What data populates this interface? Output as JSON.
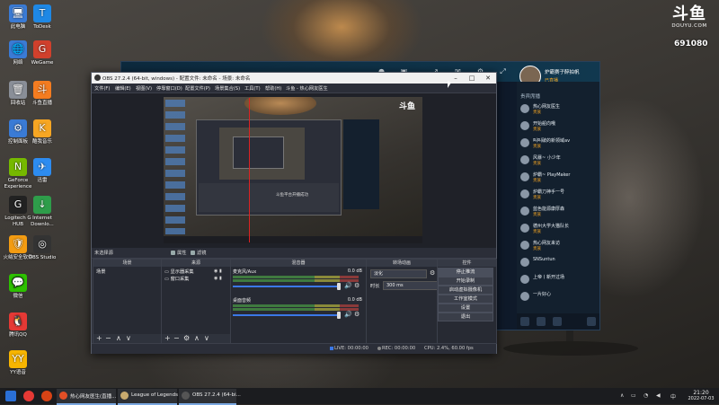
{
  "desktop_icons": [
    {
      "label": "此电脑",
      "color": "#3a7bd5",
      "glyph": "🖥"
    },
    {
      "label": "ToDesk",
      "color": "#1e88e5",
      "glyph": "T"
    },
    {
      "label": "网络",
      "color": "#3a7bd5",
      "glyph": "🌐"
    },
    {
      "label": "WeGame",
      "color": "#d0402c",
      "glyph": "G"
    },
    {
      "label": "回收站",
      "color": "#8a8f98",
      "glyph": "🗑"
    },
    {
      "label": "斗鱼直播",
      "color": "#f47c20",
      "glyph": "斗"
    },
    {
      "label": "控制面板",
      "color": "#3a7bd5",
      "glyph": "⚙"
    },
    {
      "label": "酷我音乐",
      "color": "#f6a623",
      "glyph": "K"
    },
    {
      "label": "GeForce Experience",
      "color": "#76b900",
      "glyph": "N"
    },
    {
      "label": "迅雷",
      "color": "#2d8cf0",
      "glyph": "✈"
    },
    {
      "label": "Logitech G HUB",
      "color": "#222222",
      "glyph": "G"
    },
    {
      "label": "Internet Downlo...",
      "color": "#2e9d4a",
      "glyph": "↓"
    },
    {
      "label": "火绒安全软件",
      "color": "#f39c12",
      "glyph": "🛡"
    },
    {
      "label": "OBS Studio",
      "color": "#333333",
      "glyph": "◎"
    },
    {
      "label": "微信",
      "color": "#2dc100",
      "glyph": "💬"
    },
    {
      "label": "腾讯QQ",
      "color": "#e53935",
      "glyph": "🐧"
    },
    {
      "label": "YY语音",
      "color": "#f7b500",
      "glyph": "YY"
    }
  ],
  "douyu_logo": {
    "mark": "斗鱼",
    "domain": "DOUYU.COM"
  },
  "room_id": "691080",
  "douyu_window": {
    "streamer_name": "炉霸赛子醉拍帆",
    "streamer_status": "已直播",
    "panel_header": "贵宾席播",
    "viewers": [
      {
        "name": "热心网友医生",
        "level": "贵族"
      },
      {
        "name": "开始船向哦",
        "level": "贵族"
      },
      {
        "name": "叫叫破的新领域av",
        "level": "贵族"
      },
      {
        "name": "风暴~ 小少年",
        "level": "贵族"
      },
      {
        "name": "炉霸~ PlayMaker",
        "level": "贵族"
      },
      {
        "name": "炉霸刀神手一号",
        "level": "贵族"
      },
      {
        "name": "蓝色能源康厚森",
        "level": "贵族"
      },
      {
        "name": "德州大学大猫队长",
        "level": "贵族"
      },
      {
        "name": "热心网友来访",
        "level": "贵族"
      },
      {
        "name": "SNSuntun",
        "level": ""
      },
      {
        "name": "上帝丨新开过场",
        "level": ""
      },
      {
        "name": "一片好心",
        "level": ""
      }
    ]
  },
  "obs": {
    "title": "OBS 27.2.4 (64-bit, windows) - 配置文件: 未命名 - 场景: 未命名",
    "window_buttons": [
      "–",
      "□",
      "✕"
    ],
    "menu": [
      "文件(F)",
      "编辑(E)",
      "视图(V)",
      "停靠窗口(D)",
      "配置文件(P)",
      "场景集合(S)",
      "工具(T)",
      "帮助(H)",
      "斗鱼 - 热心网友医生"
    ],
    "preview_inner_text": "斗鱼平台开播成功",
    "preview_logo": "斗鱼",
    "source_bar": {
      "label": "未选择源",
      "properties": "属性",
      "filters": "滤镜"
    },
    "docks": {
      "scenes": {
        "title": "场景",
        "items": [
          "场景"
        ]
      },
      "sources": {
        "title": "来源",
        "items": [
          "显示器采集",
          "窗口采集"
        ]
      },
      "mixer": {
        "title": "混音器",
        "channels": [
          {
            "name": "麦克风/Aux",
            "db": "0.0 dB"
          },
          {
            "name": "桌面音频",
            "db": "0.0 dB"
          }
        ]
      },
      "transitions": {
        "title": "转场动画",
        "type": "淡化",
        "duration_label": "时长",
        "duration": "300 ms"
      },
      "controls": {
        "title": "控件",
        "buttons": [
          "停止推流",
          "开始录制",
          "启动虚拟摄像机",
          "工作室模式",
          "设置",
          "退出"
        ]
      }
    },
    "status": {
      "live": "LIVE: 00:00:00",
      "rec": "REC: 00:00:00",
      "cpu": "CPU: 2.4%, 60.00 fps"
    }
  },
  "taskbar": {
    "tasks": [
      {
        "label": "热心网友医生(直播...",
        "color": "#e34f26"
      },
      {
        "label": "League of Legends",
        "color": "#c8aa6e"
      },
      {
        "label": "OBS 27.2.4 (64-bi...",
        "color": "#333333"
      }
    ],
    "time": "21:20",
    "date": "2022-07-03",
    "ime": "中"
  }
}
